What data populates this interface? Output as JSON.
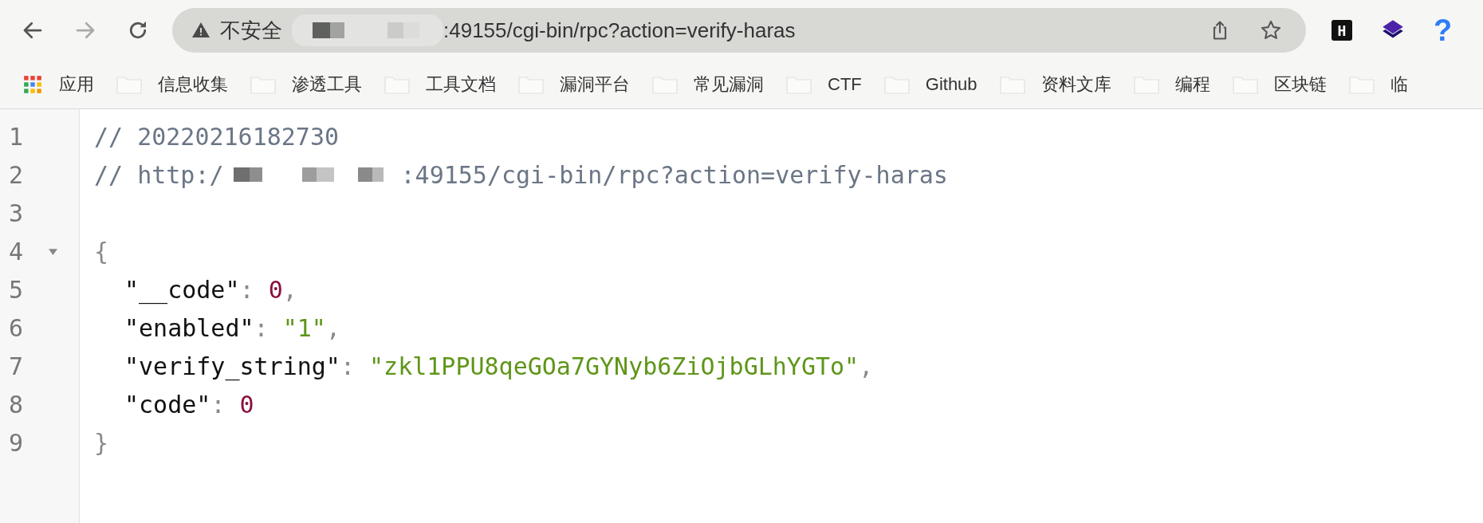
{
  "nav_buttons": [
    {
      "kind": "back",
      "disabled": false
    },
    {
      "kind": "forward",
      "disabled": true
    },
    {
      "kind": "reload",
      "disabled": false
    }
  ],
  "address_bar": {
    "security": "不安全",
    "url": ":49155/cgi-bin/rpc?action=verify-haras"
  },
  "extensions": [
    {
      "kind": "badge",
      "label": "H"
    },
    {
      "kind": "layers"
    },
    {
      "kind": "help",
      "label": "?"
    }
  ],
  "bookmarks": [
    {
      "kind": "apps",
      "label": "应用"
    },
    {
      "kind": "folder",
      "label": "信息收集"
    },
    {
      "kind": "folder",
      "label": "渗透工具"
    },
    {
      "kind": "folder",
      "label": "工具文档"
    },
    {
      "kind": "folder",
      "label": "漏洞平台"
    },
    {
      "kind": "folder",
      "label": "常见漏洞"
    },
    {
      "kind": "folder",
      "label": "CTF"
    },
    {
      "kind": "folder",
      "label": "Github"
    },
    {
      "kind": "folder",
      "label": "资料文库"
    },
    {
      "kind": "folder",
      "label": "编程"
    },
    {
      "kind": "folder",
      "label": "区块链"
    },
    {
      "kind": "folder",
      "label": "临"
    }
  ],
  "lines": [
    {
      "number": "1",
      "tokens": [
        {
          "kind": "comment",
          "text": "// 20220216182730"
        }
      ]
    },
    {
      "number": "2",
      "tokens": [
        {
          "kind": "comment",
          "text": "// http:/"
        },
        {
          "kind": "redacted"
        },
        {
          "kind": "comment",
          "text": ":49155/cgi-bin/rpc?action=verify-haras"
        }
      ]
    },
    {
      "number": "3"
    },
    {
      "number": "4",
      "fold": {
        "expanded": true
      },
      "tokens": [
        {
          "kind": "punct",
          "text": "{"
        }
      ]
    },
    {
      "number": "5",
      "indented": true,
      "tokens": [
        {
          "kind": "key",
          "text": "\"__code\""
        },
        {
          "kind": "punct",
          "text": ": "
        },
        {
          "kind": "number",
          "text": "0"
        },
        {
          "kind": "punct",
          "text": ","
        }
      ]
    },
    {
      "number": "6",
      "indented": true,
      "tokens": [
        {
          "kind": "key",
          "text": "\"enabled\""
        },
        {
          "kind": "punct",
          "text": ": "
        },
        {
          "kind": "string",
          "text": "\"1\""
        },
        {
          "kind": "punct",
          "text": ","
        }
      ]
    },
    {
      "number": "7",
      "indented": true,
      "tokens": [
        {
          "kind": "key",
          "text": "\"verify_string\""
        },
        {
          "kind": "punct",
          "text": ": "
        },
        {
          "kind": "string",
          "text": "\"zkl1PPU8qeGOa7GYNyb6ZiOjbGLhYGTo\""
        },
        {
          "kind": "punct",
          "text": ","
        }
      ]
    },
    {
      "number": "8",
      "indented": true,
      "tokens": [
        {
          "kind": "key",
          "text": "\"code\""
        },
        {
          "kind": "punct",
          "text": ": "
        },
        {
          "kind": "number",
          "text": "0"
        }
      ]
    },
    {
      "number": "9",
      "tokens": [
        {
          "kind": "punct",
          "text": "}"
        }
      ]
    }
  ]
}
